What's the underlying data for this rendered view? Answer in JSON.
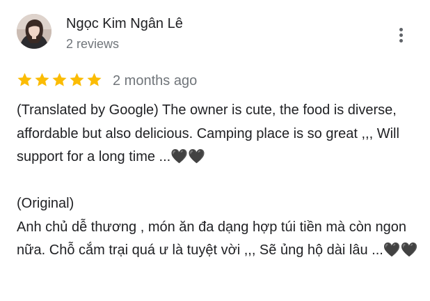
{
  "review": {
    "author_name": "Ngọc Kim Ngân Lê",
    "review_count": "2 reviews",
    "rating": 5,
    "rating_max": 5,
    "date": "2 months ago",
    "translated_text": "(Translated by Google) The owner is cute, the food is diverse, affordable but also delicious. Camping place is so great ,,, Will support for a long time ...🖤🖤",
    "original_label": "(Original)",
    "original_text": "Anh chủ dễ thương , món ăn đa dạng hợp túi tiền mà còn ngon nữa.  Chỗ cắm trại quá ư là tuyệt vời ,,, Sẽ ủng hộ dài lâu ...🖤🖤"
  },
  "icons": {
    "avatar": "user-photo",
    "more": "more-vertical-icon",
    "star": "star-icon"
  },
  "colors": {
    "star": "#fbbc04",
    "text": "#202124",
    "secondary_text": "#70757a",
    "icon": "#5f6368"
  }
}
